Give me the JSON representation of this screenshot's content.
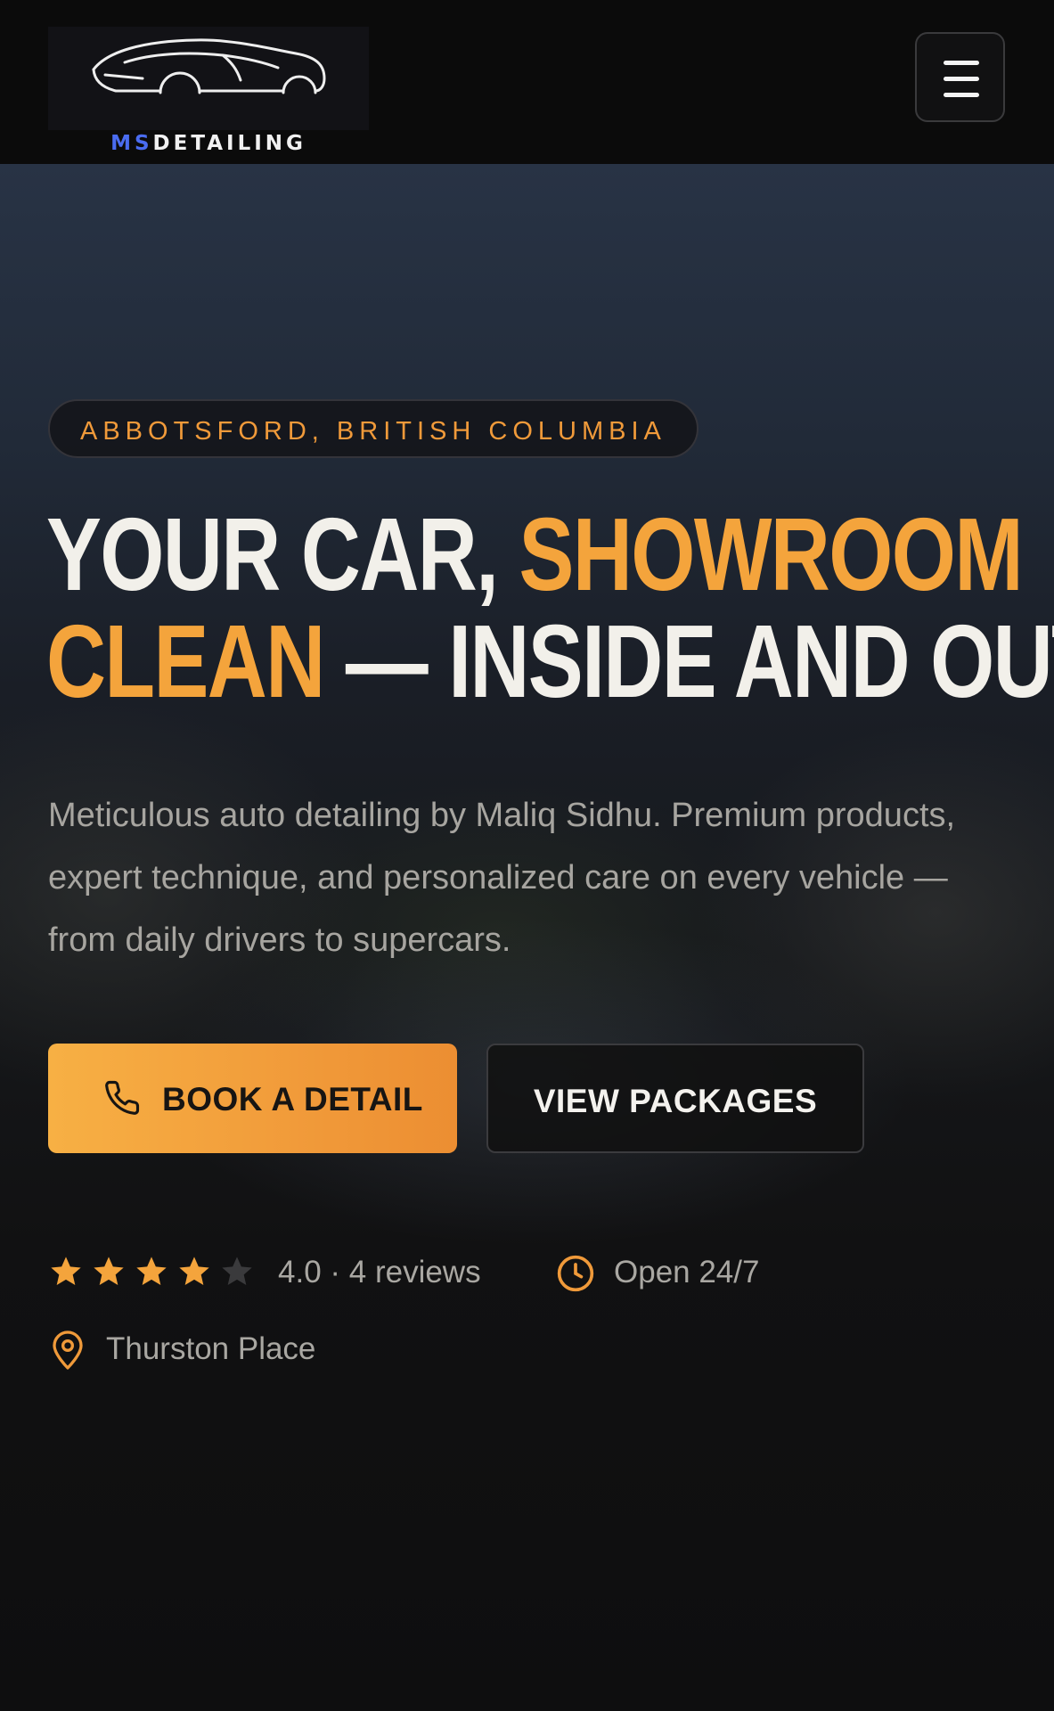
{
  "brand": {
    "ms": "MS",
    "detailing": "DETAILING"
  },
  "header": {
    "menu_icon": "hamburger-menu-icon"
  },
  "hero": {
    "location": "ABBOTSFORD, BRITISH COLUMBIA",
    "headline": {
      "part1": "YOUR CAR, ",
      "part2": "SHOWROOM",
      "part3": "CLEAN",
      "part4": " — INSIDE AND OUT."
    },
    "description": "Meticulous auto detailing by Maliq Sidhu. Premium products, expert technique, and personalized care on every vehicle — from daily drivers to supercars.",
    "book_label": "BOOK A DETAIL",
    "view_label": "VIEW PACKAGES",
    "rating": {
      "value": 4.0,
      "max": 5,
      "text": "4.0 · 4 reviews"
    },
    "hours": "Open 24/7",
    "place": "Thurston Place"
  },
  "colors": {
    "accent": "#f4a43c",
    "background": "#0e0e0f",
    "brand_blue": "#4a6cf0",
    "star_empty": "#3a3a3c"
  },
  "icons": {
    "logo": "sports-car-logo-icon",
    "book": "phone-icon",
    "hours": "clock-icon",
    "place": "map-pin-icon",
    "rating": "star-icon"
  }
}
